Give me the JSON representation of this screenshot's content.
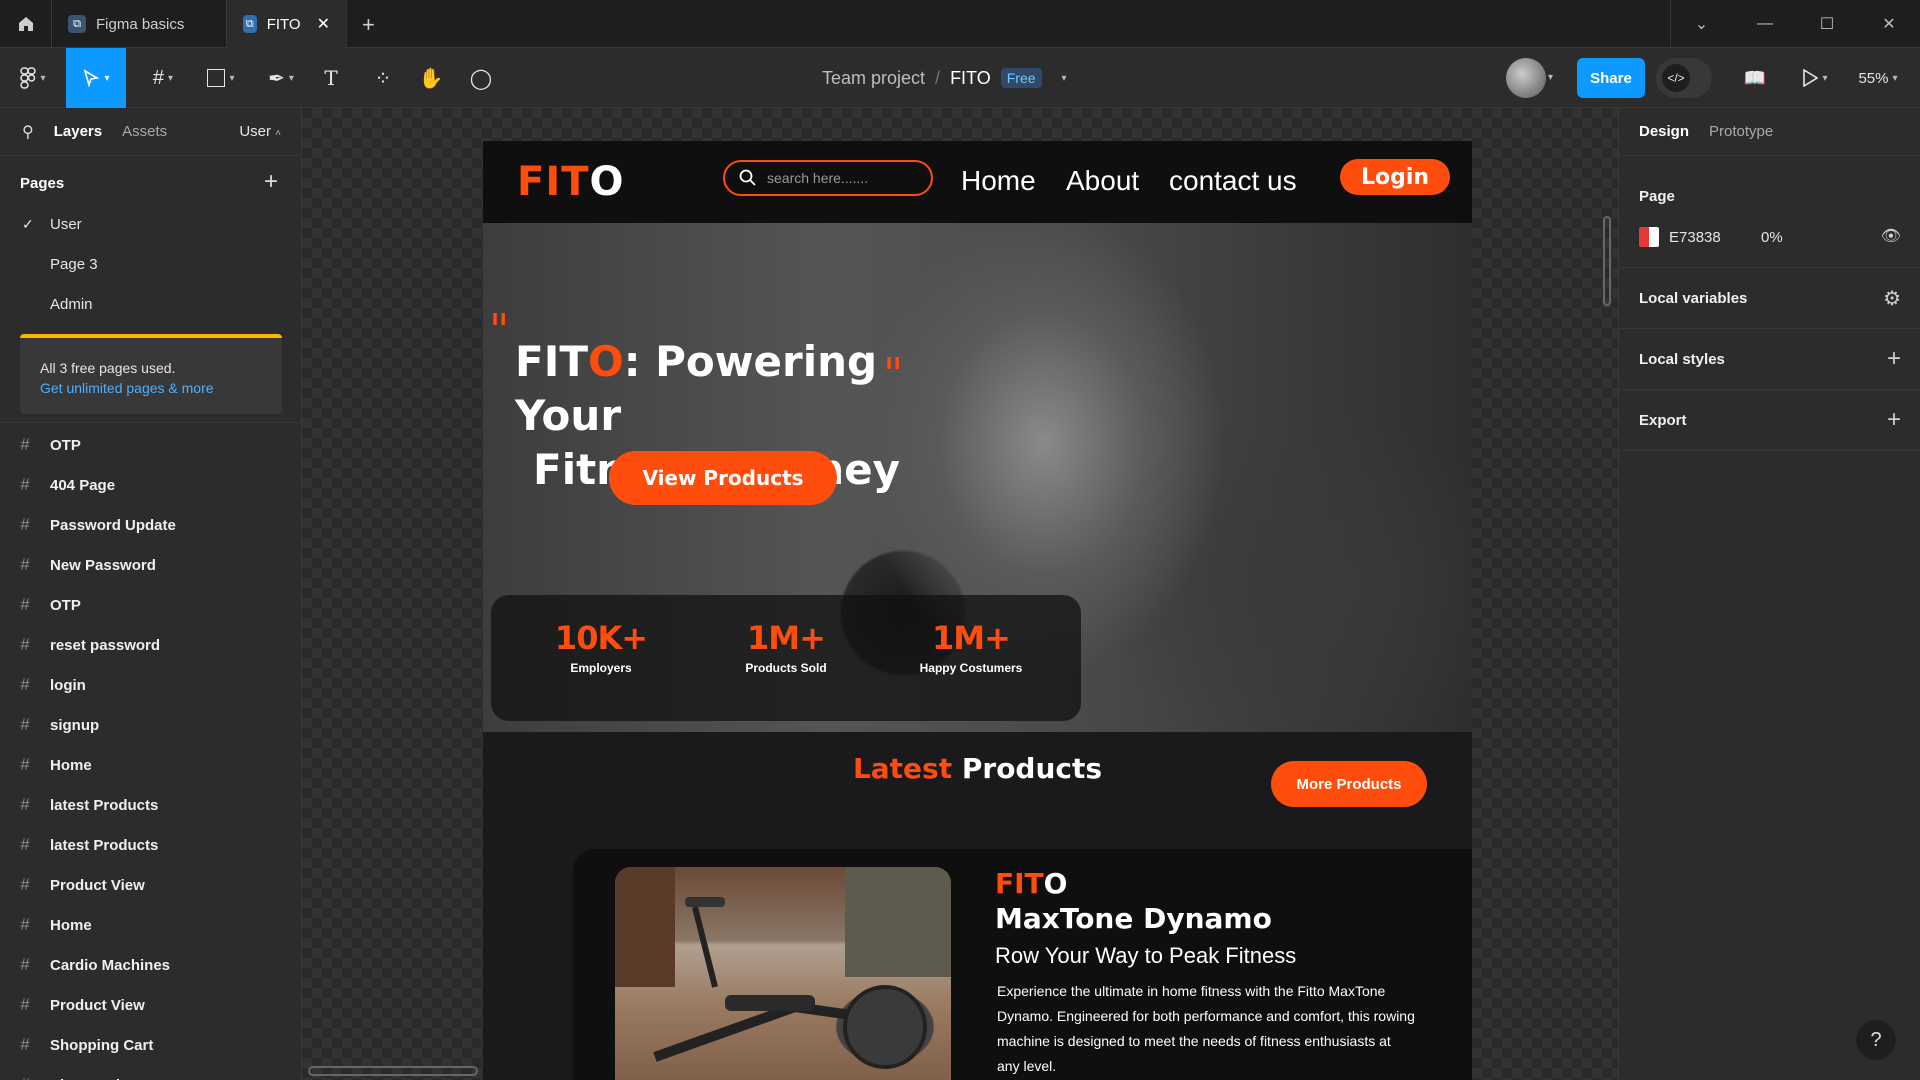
{
  "tabs": [
    {
      "label": "Figma basics"
    },
    {
      "label": "FITO"
    }
  ],
  "toolbar": {
    "breadcrumb_project": "Team project",
    "breadcrumb_sep": "/",
    "file_name": "FITO",
    "plan_badge": "Free",
    "share_label": "Share",
    "zoom": "55%"
  },
  "left": {
    "tab_layers": "Layers",
    "tab_assets": "Assets",
    "page_selector": "User",
    "pages_title": "Pages",
    "pages": [
      "User",
      "Page 3",
      "Admin"
    ],
    "notice_text": "All 3 free pages used.",
    "notice_link": "Get unlimited pages & more",
    "layers": [
      "OTP",
      "404 Page",
      "Password Update",
      "New Password",
      "OTP",
      "reset password",
      "login",
      "signup",
      "Home",
      "latest Products",
      "latest Products",
      "Product View",
      "Home",
      "Cardio Machines",
      "Product View",
      "Shopping Cart",
      "Place Order"
    ]
  },
  "site": {
    "logo_a": "FIT",
    "logo_b": "O",
    "search_placeholder": "search here.......",
    "nav": [
      "Home",
      "About",
      "contact us"
    ],
    "login": "Login",
    "hero_quote_open": "\"",
    "hero_quote_close": "\"",
    "hero_title_a": "FIT",
    "hero_title_b": "O",
    "hero_title_c": ": Powering Your",
    "hero_title_line2": "Fitness Journey",
    "hero_button": "View Products",
    "stats": [
      {
        "value": "10K+",
        "label": "Employers"
      },
      {
        "value": "1M+",
        "label": "Products Sold"
      },
      {
        "value": "1M+",
        "label": "Happy Costumers"
      }
    ],
    "latest_a": "Latest",
    "latest_b": "Products",
    "more_button": "More Products",
    "product": {
      "brand_a": "FIT",
      "brand_b": "O",
      "name": "MaxTone Dynamo",
      "tagline": "Row Your Way to Peak Fitness",
      "description": "Experience the ultimate in home fitness with the Fitto MaxTone Dynamo. Engineered for both performance and comfort, this rowing machine is designed to meet the needs of fitness enthusiasts at any level."
    }
  },
  "right": {
    "tab_design": "Design",
    "tab_prototype": "Prototype",
    "page_label": "Page",
    "page_color_hex": "E73838",
    "page_opacity": "0%",
    "local_variables": "Local variables",
    "local_styles": "Local styles",
    "export": "Export"
  },
  "colors": {
    "figma_blue": "#0d99ff",
    "brand_orange": "#ff4d0d",
    "page_fill": "#E73838"
  },
  "icons": [
    "home-icon",
    "close-icon",
    "plus-icon",
    "chevron-down-icon",
    "minimize-icon",
    "maximize-icon",
    "figma-menu-icon",
    "move-tool-icon",
    "frame-tool-icon",
    "shape-tool-icon",
    "pen-tool-icon",
    "text-tool-icon",
    "component-tool-icon",
    "hand-tool-icon",
    "comment-tool-icon",
    "search-icon",
    "check-icon",
    "hash-icon",
    "eye-icon",
    "sliders-icon",
    "book-icon",
    "play-icon",
    "code-icon",
    "help-icon"
  ]
}
